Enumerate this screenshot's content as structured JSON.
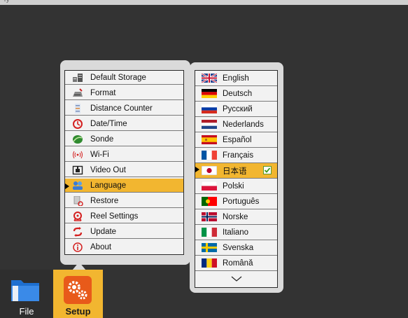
{
  "top_fragment": "ry",
  "settings_menu": {
    "items": [
      {
        "label": "Default Storage",
        "icon": "storage-icon"
      },
      {
        "label": "Format",
        "icon": "format-icon"
      },
      {
        "label": "Distance Counter",
        "icon": "distance-counter-icon"
      },
      {
        "label": "Date/Time",
        "icon": "clock-icon"
      },
      {
        "label": "Sonde",
        "icon": "sonde-icon"
      },
      {
        "label": "Wi-Fi",
        "icon": "wifi-icon"
      },
      {
        "label": "Video Out",
        "icon": "video-out-icon"
      },
      {
        "label": "Language",
        "icon": "language-icon"
      },
      {
        "label": "Restore",
        "icon": "restore-icon"
      },
      {
        "label": "Reel Settings",
        "icon": "reel-icon"
      },
      {
        "label": "Update",
        "icon": "update-icon"
      },
      {
        "label": "About",
        "icon": "info-icon"
      }
    ],
    "selected": "Language"
  },
  "language_menu": {
    "items": [
      {
        "label": "English",
        "flag": "uk-flag-icon"
      },
      {
        "label": "Deutsch",
        "flag": "germany-flag-icon"
      },
      {
        "label": "Русский",
        "flag": "russia-flag-icon"
      },
      {
        "label": "Nederlands",
        "flag": "netherlands-flag-icon"
      },
      {
        "label": "Español",
        "flag": "spain-flag-icon"
      },
      {
        "label": "Français",
        "flag": "france-flag-icon"
      },
      {
        "label": "日本语",
        "flag": "japan-flag-icon"
      },
      {
        "label": "Polski",
        "flag": "poland-flag-icon"
      },
      {
        "label": "Português",
        "flag": "portugal-flag-icon"
      },
      {
        "label": "Norske",
        "flag": "norway-flag-icon"
      },
      {
        "label": "Italiano",
        "flag": "italy-flag-icon"
      },
      {
        "label": "Svenska",
        "flag": "sweden-flag-icon"
      },
      {
        "label": "Română",
        "flag": "romania-flag-icon"
      }
    ],
    "selected": "日本语",
    "more_icon": "chevron-down-icon"
  },
  "dock": {
    "file_label": "File",
    "setup_label": "Setup"
  },
  "colors": {
    "background": "#333333",
    "accent": "#f2b630",
    "panel": "#dadada"
  }
}
